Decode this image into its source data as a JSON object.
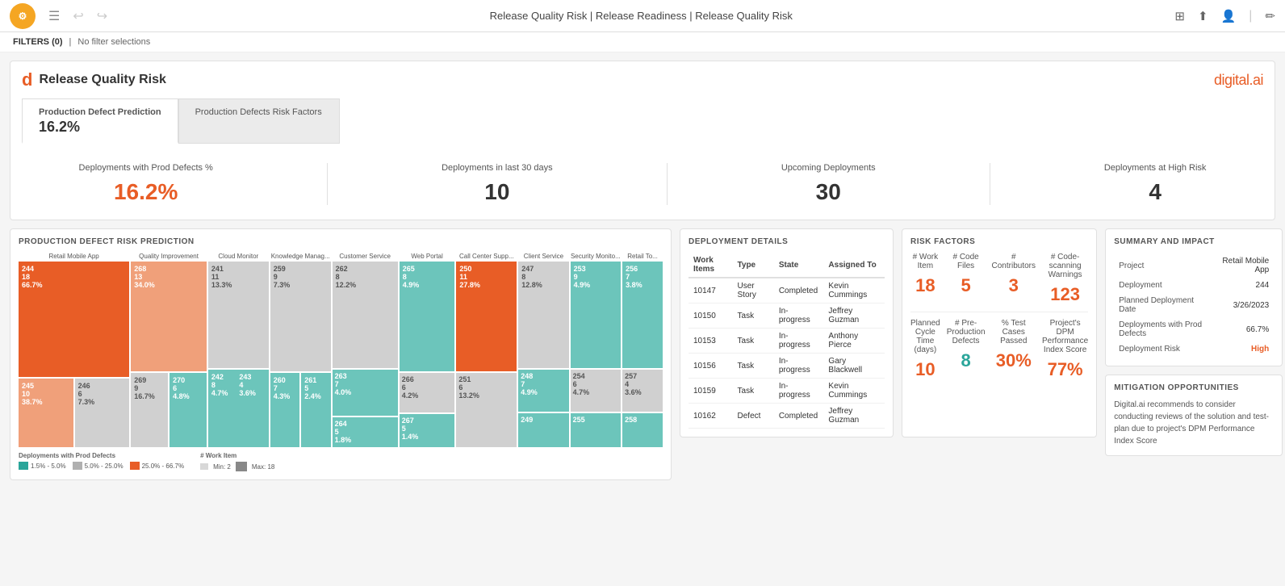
{
  "topbar": {
    "title": "Release Quality Risk | Release Readiness | Release Quality Risk",
    "logo_text": "d"
  },
  "filters": {
    "label": "FILTERS (0)",
    "text": "No filter selections"
  },
  "header": {
    "brand_d": "d",
    "title": "Release Quality Risk",
    "logo": "digital.ai"
  },
  "tabs": [
    {
      "label": "Production Defect Prediction",
      "value": "16.2%",
      "active": true
    },
    {
      "label": "Production Defects Risk Factors",
      "value": "",
      "active": false
    }
  ],
  "kpis": [
    {
      "label": "Deployments with Prod Defects %",
      "value": "16.2%",
      "color": "orange"
    },
    {
      "label": "Deployments in last 30 days",
      "value": "10",
      "color": "dark"
    },
    {
      "label": "Upcoming Deployments",
      "value": "30",
      "color": "dark"
    },
    {
      "label": "Deployments at High Risk",
      "value": "4",
      "color": "dark"
    }
  ],
  "treemap": {
    "section_title": "PRODUCTION DEFECT RISK PREDICTION",
    "columns": [
      {
        "label": "Retail Mobile App"
      },
      {
        "label": "Quality Improvement"
      },
      {
        "label": "Cloud Monitor"
      },
      {
        "label": "Knowledge Manag..."
      },
      {
        "label": "Customer Service"
      },
      {
        "label": "Web Portal"
      },
      {
        "label": "Call Center Supp..."
      },
      {
        "label": "Client Service"
      },
      {
        "label": "Security Monito..."
      },
      {
        "label": "Retail To..."
      }
    ],
    "legend_prod_defects": {
      "title": "Deployments with Prod Defects",
      "items": [
        {
          "label": "1.5% - 5.0%",
          "color": "teal-dark"
        },
        {
          "label": "5.0% - 25.0%",
          "color": "gray"
        },
        {
          "label": "25.0% - 66.7%",
          "color": "orange"
        }
      ]
    },
    "legend_work_item": {
      "title": "# Work Item",
      "items": [
        {
          "label": "Min: 2",
          "color": "light"
        },
        {
          "label": "Max: 18",
          "color": "dark"
        }
      ]
    }
  },
  "deployment_details": {
    "section_title": "DEPLOYMENT DETAILS",
    "columns": [
      "Work Items",
      "Type",
      "State",
      "Assigned To"
    ],
    "rows": [
      {
        "work_items": "10147",
        "type": "User Story",
        "state": "Completed",
        "assigned": "Kevin Cummings"
      },
      {
        "work_items": "10150",
        "type": "Task",
        "state": "In-progress",
        "assigned": "Jeffrey Guzman"
      },
      {
        "work_items": "10153",
        "type": "Task",
        "state": "In-progress",
        "assigned": "Anthony Pierce"
      },
      {
        "work_items": "10156",
        "type": "Task",
        "state": "In-progress",
        "assigned": "Gary Blackwell"
      },
      {
        "work_items": "10159",
        "type": "Task",
        "state": "In-progress",
        "assigned": "Kevin Cummings"
      },
      {
        "work_items": "10162",
        "type": "Defect",
        "state": "Completed",
        "assigned": "Jeffrey Guzman"
      }
    ]
  },
  "summary": {
    "section_title": "SUMMARY AND IMPACT",
    "rows": [
      {
        "label": "Project",
        "value": "Retail Mobile App"
      },
      {
        "label": "Deployment",
        "value": "244"
      },
      {
        "label": "Planned Deployment Date",
        "value": "3/26/2023"
      },
      {
        "label": "Deployments with Prod Defects",
        "value": "66.7%"
      },
      {
        "label": "Deployment Risk",
        "value": "High",
        "color": "red"
      }
    ]
  },
  "risk_factors": {
    "section_title": "RISK FACTORS",
    "items": [
      {
        "label": "# Work Item",
        "value": "18",
        "color": "orange"
      },
      {
        "label": "# Code Files",
        "value": "5",
        "color": "orange"
      },
      {
        "label": "# Contributors",
        "value": "3",
        "color": "orange"
      },
      {
        "label": "# Code-scanning Warnings",
        "value": "123",
        "color": "orange"
      },
      {
        "label": "Planned Cycle Time (days)",
        "value": "10",
        "color": "orange"
      },
      {
        "label": "# Pre-Production Defects",
        "value": "8",
        "color": "green"
      },
      {
        "label": "% Test Cases Passed",
        "value": "30%",
        "color": "orange"
      },
      {
        "label": "Project's DPM Performance Index Score",
        "value": "77%",
        "color": "orange"
      }
    ]
  },
  "mitigation": {
    "section_title": "MITIGATION OPPORTUNITIES",
    "text": "Digital.ai recommends to consider conducting reviews of the solution and test-plan due to project's DPM Performance Index Score"
  }
}
